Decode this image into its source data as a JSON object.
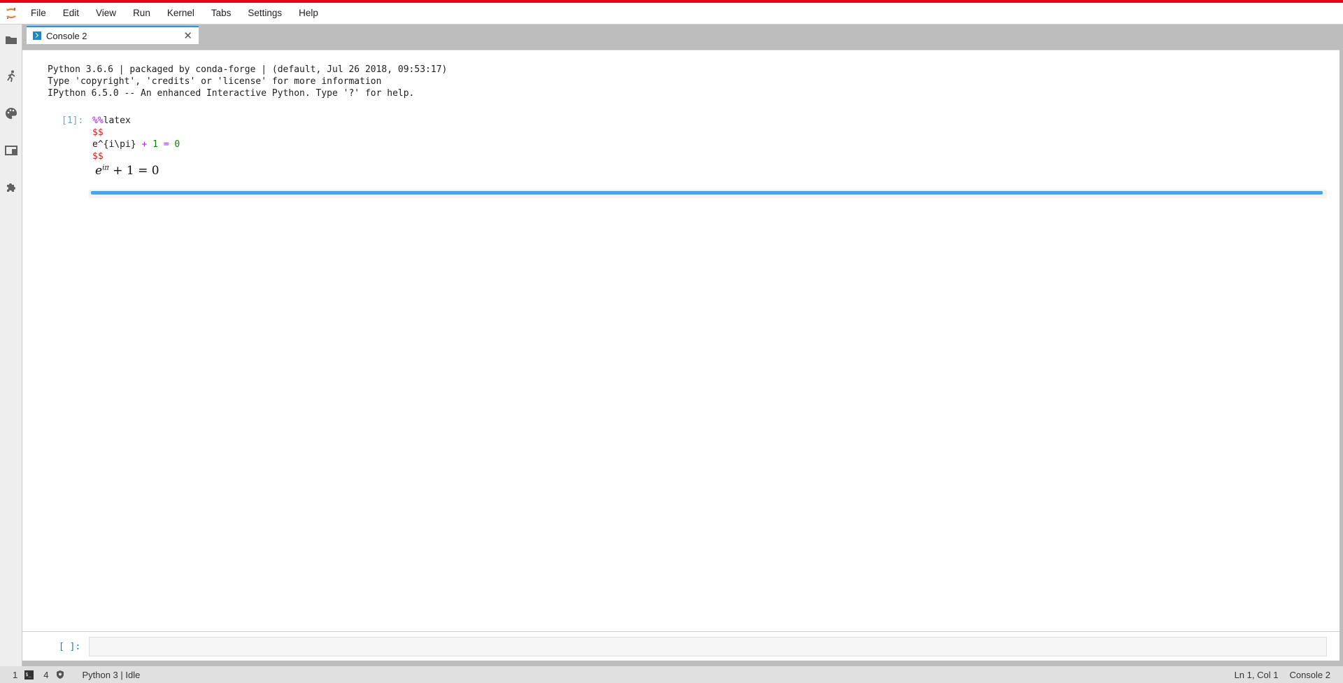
{
  "colors": {
    "accent": "#e30613",
    "tab_accent": "#2196f3",
    "bar": "#42a5f5"
  },
  "menu": {
    "items": [
      "File",
      "Edit",
      "View",
      "Run",
      "Kernel",
      "Tabs",
      "Settings",
      "Help"
    ]
  },
  "sidebar": {
    "icons": [
      "folder-icon",
      "running-icon",
      "palette-icon",
      "tabs-icon",
      "extension-icon"
    ]
  },
  "tab": {
    "label": "Console 2",
    "close_glyph": "✕"
  },
  "console": {
    "banner": [
      "Python 3.6.6 | packaged by conda-forge | (default, Jul 26 2018, 09:53:17)",
      "Type 'copyright', 'credits' or 'license' for more information",
      "IPython 6.5.0 -- An enhanced Interactive Python. Type '?' for help."
    ],
    "cell1": {
      "prompt": "[1]:",
      "code": {
        "magic": "%%",
        "magic_name": "latex",
        "dollar": "$$",
        "expr_base": "e^{i\\pi}",
        "plus": "+",
        "one": "1",
        "eq": "=",
        "zero": "0"
      },
      "output": {
        "base": "e",
        "exponent": "iπ",
        "rest": "+ 1 = 0"
      }
    },
    "input_prompt": "[ ]:"
  },
  "status": {
    "left_count_1": "1",
    "left_count_2": "4",
    "kernel": "Python 3 | Idle",
    "cursor": "Ln 1, Col 1",
    "doc": "Console 2"
  }
}
